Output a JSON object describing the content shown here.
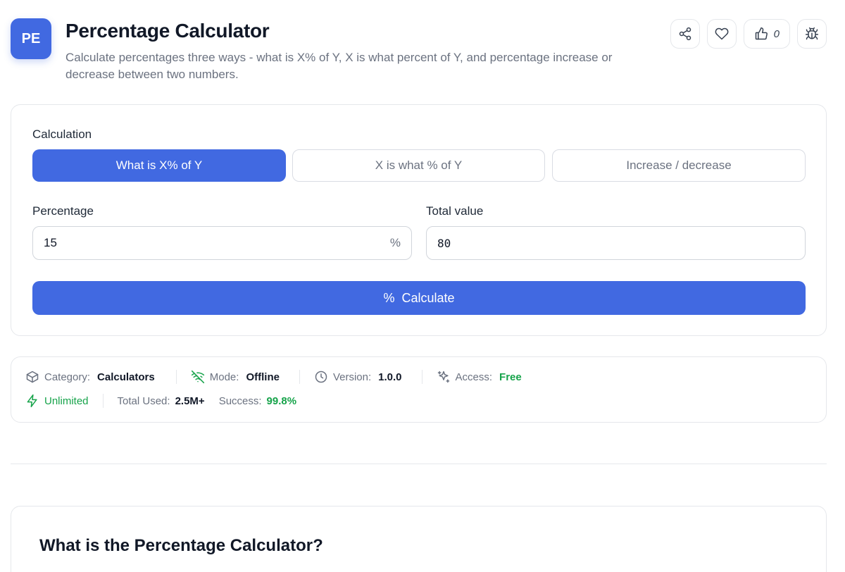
{
  "header": {
    "logo_text": "PE",
    "title": "Percentage Calculator",
    "subtitle": "Calculate percentages three ways - what is X% of Y, X is what percent of Y, and percentage increase or decrease between two numbers.",
    "like_count": "0",
    "actions": [
      "share-icon",
      "heart-icon",
      "thumbs-up-icon",
      "bug-icon"
    ]
  },
  "calculator": {
    "calculation_label": "Calculation",
    "tabs": [
      {
        "label": "What is X% of Y",
        "active": true
      },
      {
        "label": "X is what % of Y",
        "active": false
      },
      {
        "label": "Increase / decrease",
        "active": false
      }
    ],
    "percentage_label": "Percentage",
    "percentage_value": "15",
    "percentage_suffix": "%",
    "total_label": "Total value",
    "total_value": "80",
    "calculate_icon": "%",
    "calculate_label": "Calculate"
  },
  "meta": {
    "category_label": "Category:",
    "category_value": "Calculators",
    "mode_label": "Mode:",
    "mode_value": "Offline",
    "version_label": "Version:",
    "version_value": "1.0.0",
    "access_label": "Access:",
    "access_value": "Free",
    "unlimited_label": "Unlimited",
    "total_used_label": "Total Used:",
    "total_used_value": "2.5M+",
    "success_label": "Success:",
    "success_value": "99.8%"
  },
  "info": {
    "title": "What is the Percentage Calculator?"
  },
  "colors": {
    "accent": "#4169e1",
    "success": "#16a34a"
  }
}
